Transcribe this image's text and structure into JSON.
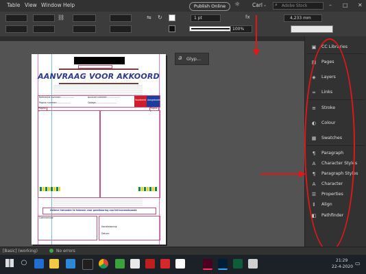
{
  "menubar": {
    "items": [
      "Table",
      "View",
      "Window",
      "Help"
    ],
    "zoom_value": "100%",
    "publish_label": "Publish Online",
    "user_label": "Carl",
    "search_placeholder": "Adobe Stock"
  },
  "control_panel": {
    "stroke_weight": "1 pt",
    "width_value": "4,233 mm",
    "percent_value": "100%",
    "fx_label": "fx"
  },
  "glyphs_panel": {
    "label": "Glyp..."
  },
  "document": {
    "title": "AANVRAAG VOOR AKKOORD",
    "ref_label": "Referentie nummer:...................",
    "account_label": "Account nummer:..................",
    "page_label": "Pagina nummer:....................",
    "oplage_label": "Oplage:.............................",
    "btn_red": "Voorbeeld",
    "btn_blue": "Aangeboden",
    "page_tag_left": "Pagina 1",
    "page_tag_right": "Pagina 2",
    "note_footer": "Gelieve hieronder te tekenen voor goedkeuring van het bovenstaande",
    "comment_label": "Commentaar",
    "sign_label": "Handtekening:",
    "date_label": "Datum:"
  },
  "right_panel": {
    "items": [
      {
        "label": "CC Libraries",
        "icon": "cc-libraries-icon"
      },
      {
        "label": "Pages",
        "icon": "pages-icon"
      },
      {
        "label": "Layers",
        "icon": "layers-icon"
      },
      {
        "label": "Links",
        "icon": "links-icon"
      },
      {
        "label": "Stroke",
        "icon": "stroke-icon"
      },
      {
        "label": "Colour",
        "icon": "colour-icon"
      },
      {
        "label": "Swatches",
        "icon": "swatches-icon"
      },
      {
        "label": "Paragraph",
        "icon": "paragraph-icon"
      },
      {
        "label": "Character Styles",
        "icon": "character-styles-icon"
      },
      {
        "label": "Paragraph Styles",
        "icon": "paragraph-styles-icon"
      },
      {
        "label": "Character",
        "icon": "character-icon"
      },
      {
        "label": "Properties",
        "icon": "properties-icon"
      },
      {
        "label": "Align",
        "icon": "align-icon"
      },
      {
        "label": "Pathfinder",
        "icon": "pathfinder-icon"
      }
    ]
  },
  "statusbar": {
    "state": "[Basic] (working)",
    "errors": "No errors"
  },
  "taskbar": {
    "time": "21:29",
    "date": "22-4-2020"
  },
  "colors": {
    "annotation": "#e01818",
    "title_blue": "#2b3a8f",
    "accent_red": "#d01c2c",
    "accent_blue": "#1f3b9c"
  }
}
